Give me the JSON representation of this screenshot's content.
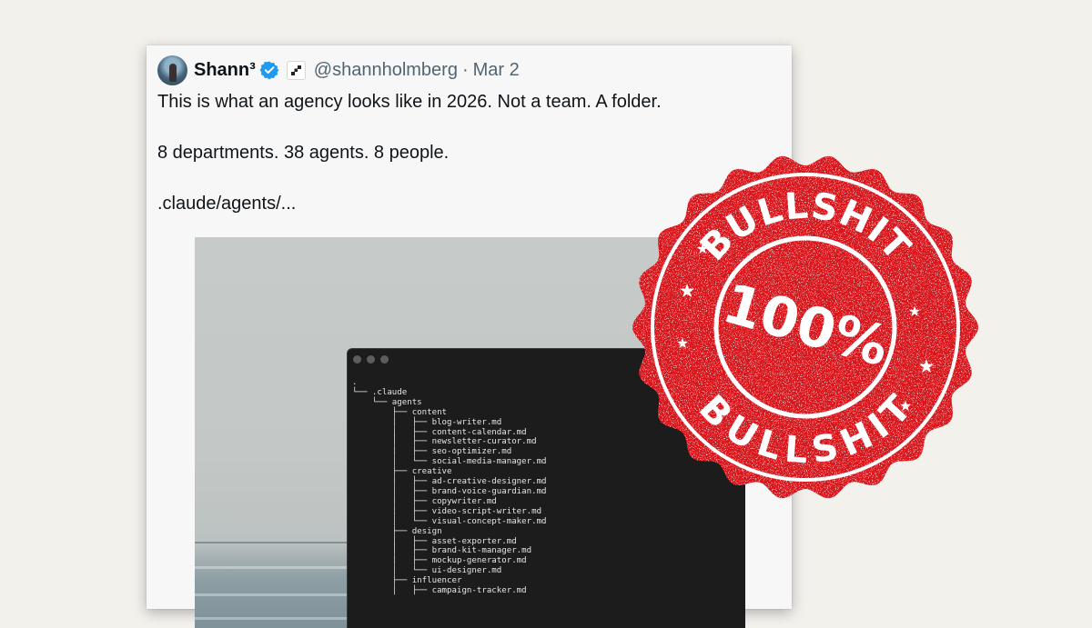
{
  "background_color": "#f3f1ec",
  "tweet": {
    "display_name": "Shann³",
    "handle": "@shannholmberg",
    "separator": "·",
    "date": "Mar 2",
    "verified_icon": "verified-badge-icon",
    "affiliate_icon": "affiliate-badge-icon",
    "text_lines": [
      "This is what an agency looks like in 2026. Not a team. A folder.",
      "8 departments. 38 agents. 8 people.",
      ".claude/agents/..."
    ]
  },
  "terminal": {
    "lines": [
      ".",
      "└── .claude",
      "    └── agents",
      "        ├── content",
      "        │   ├── blog-writer.md",
      "        │   ├── content-calendar.md",
      "        │   ├── newsletter-curator.md",
      "        │   ├── seo-optimizer.md",
      "        │   └── social-media-manager.md",
      "        ├── creative",
      "        │   ├── ad-creative-designer.md",
      "        │   ├── brand-voice-guardian.md",
      "        │   ├── copywriter.md",
      "        │   ├── video-script-writer.md",
      "        │   └── visual-concept-maker.md",
      "        ├── design",
      "        │   ├── asset-exporter.md",
      "        │   ├── brand-kit-manager.md",
      "        │   ├── mockup-generator.md",
      "        │   └── ui-designer.md",
      "        ├── influencer",
      "        │   ├── campaign-tracker.md"
    ]
  },
  "stamp": {
    "top_text": "BULLSHIT",
    "center_text": "100%",
    "bottom_text": "BULLSHIT",
    "color": "#d8121b"
  }
}
